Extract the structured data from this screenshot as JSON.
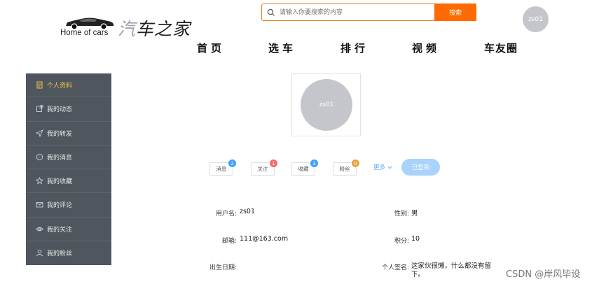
{
  "header": {
    "logo_en": "Home of cars",
    "logo_cn_first": "汽",
    "logo_cn_rest": "车之家",
    "search_placeholder": "请输入你要搜索的内容",
    "search_button": "搜索",
    "user_avatar": "zs01",
    "accent_color": "#ff6a00"
  },
  "nav": {
    "items": [
      "首页",
      "选车",
      "排行",
      "视频",
      "车友圈"
    ]
  },
  "sidebar": {
    "items": [
      {
        "label": "个人资料",
        "icon": "file-icon",
        "active": true
      },
      {
        "label": "我的动态",
        "icon": "share-box-icon"
      },
      {
        "label": "我的转发",
        "icon": "send-icon"
      },
      {
        "label": "我的消息",
        "icon": "chat-bubble-icon"
      },
      {
        "label": "我的收藏",
        "icon": "star-icon"
      },
      {
        "label": "我的评论",
        "icon": "mail-icon"
      },
      {
        "label": "我的关注",
        "icon": "eye-icon"
      },
      {
        "label": "我的粉丝",
        "icon": "user-icon"
      }
    ]
  },
  "profile": {
    "avatar_text": "zs01",
    "stats": [
      {
        "label": "消息",
        "count": "2",
        "color": "#409eff"
      },
      {
        "label": "关注",
        "count": "1",
        "color": "#f56c6c"
      },
      {
        "label": "收藏",
        "count": "3",
        "color": "#409eff"
      },
      {
        "label": "粉丝",
        "count": "0",
        "color": "#e6a23c"
      }
    ],
    "more_label": "更多",
    "checkin_label": "已签到"
  },
  "info": {
    "username_label": "用户名:",
    "username": "zs01",
    "gender_label": "性别:",
    "gender": "男",
    "email_label": "邮箱:",
    "email": "111@163.com",
    "points_label": "积分:",
    "points": "10",
    "birthday_label": "出生日期:",
    "signature_label": "个人签名:",
    "signature": "这家伙很懒，什么都没有留下。"
  },
  "watermark": "CSDN @岸风毕设"
}
